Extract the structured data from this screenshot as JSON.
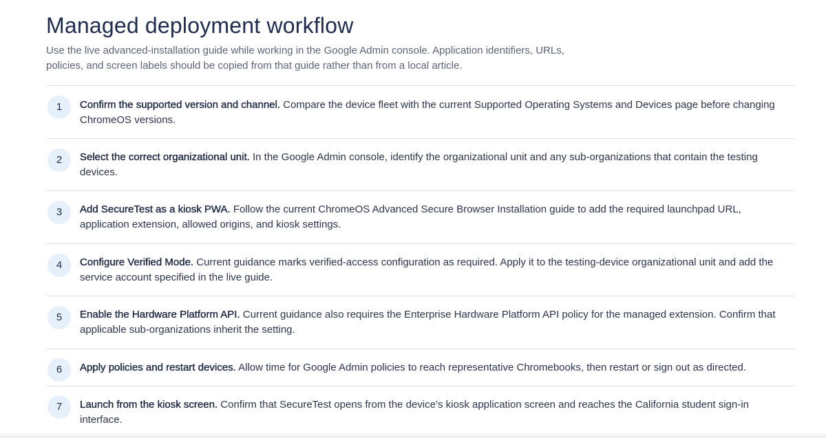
{
  "title": "Managed deployment workflow",
  "intro": "Use the live advanced-installation guide while working in the Google Admin console. Application identifiers, URLs, policies, and screen labels should be copied from that guide rather than from a local article.",
  "intro_line1": "Use the live advanced-installation guide while working in the Google Admin console. Application identifiers, URLs,",
  "intro_line2": "policies, and screen labels should be copied from that guide rather than from a local article.",
  "steps": [
    {
      "number": "1",
      "lead": "Confirm the supported version and channel.",
      "body": " Compare the device fleet with the current Supported Operating Systems and Devices page before changing ChromeOS versions."
    },
    {
      "number": "2",
      "lead": "Select the correct organizational unit.",
      "body": " In the Google Admin console, identify the organizational unit and any sub-organizations that contain the testing devices."
    },
    {
      "number": "3",
      "lead": "Add SecureTest as a kiosk PWA.",
      "body": " Follow the current ChromeOS Advanced Secure Browser Installation guide to add the required launchpad URL, application extension, allowed origins, and kiosk settings."
    },
    {
      "number": "4",
      "lead": "Configure Verified Mode.",
      "body": " Current guidance marks verified-access configuration as required. Apply it to the testing-device organizational unit and add the service account specified in the live guide."
    },
    {
      "number": "5",
      "lead": "Enable the Hardware Platform API.",
      "body": " Current guidance also requires the Enterprise Hardware Platform API policy for the managed extension. Confirm that applicable sub-organizations inherit the setting."
    },
    {
      "number": "6",
      "lead": "Apply policies and restart devices.",
      "body": " Allow time for Google Admin policies to reach representative Chromebooks, then restart or sign out as directed."
    },
    {
      "number": "7",
      "lead": "Launch from the kiosk screen.",
      "body": " Confirm that SecureTest opens from the device’s kiosk application screen and reaches the California student sign-in interface."
    }
  ]
}
